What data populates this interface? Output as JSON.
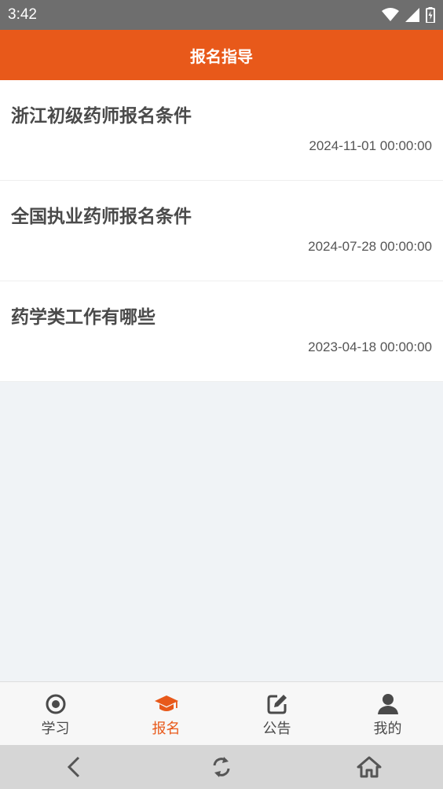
{
  "status_bar": {
    "time": "3:42"
  },
  "header": {
    "title": "报名指导"
  },
  "items": [
    {
      "title": "浙江初级药师报名条件",
      "date": "2024-11-01 00:00:00"
    },
    {
      "title": "全国执业药师报名条件",
      "date": "2024-07-28 00:00:00"
    },
    {
      "title": "药学类工作有哪些",
      "date": "2023-04-18 00:00:00"
    }
  ],
  "tabs": [
    {
      "label": "学习",
      "icon": "target-icon"
    },
    {
      "label": "报名",
      "icon": "graduation-cap-icon",
      "active": true
    },
    {
      "label": "公告",
      "icon": "edit-icon"
    },
    {
      "label": "我的",
      "icon": "user-icon"
    }
  ],
  "colors": {
    "accent": "#e8591a",
    "status_bar": "#6e6e6e",
    "background": "#f0f3f6"
  }
}
